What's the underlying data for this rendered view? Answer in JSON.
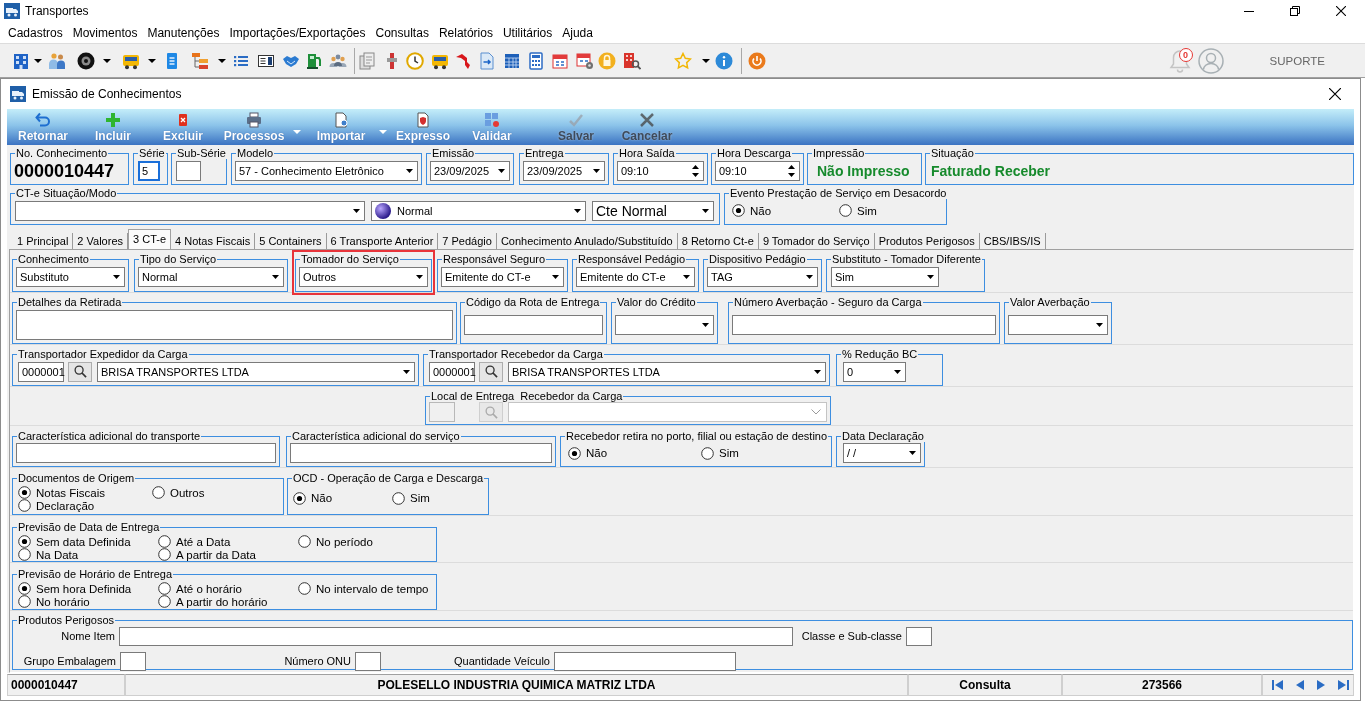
{
  "window": {
    "title": "Transportes"
  },
  "menu": [
    "Cadastros",
    "Movimentos",
    "Manutenções",
    "Importações/Exportações",
    "Consultas",
    "Relatórios",
    "Utilitários",
    "Ajuda"
  ],
  "toolbar": {
    "notifications": "0",
    "user": "SUPORTE"
  },
  "child_window": {
    "title": "Emissão de Conhecimentos"
  },
  "actions": [
    {
      "label": "Retornar",
      "dropdown": false,
      "disabled": false
    },
    {
      "label": "Incluir",
      "dropdown": false,
      "disabled": false
    },
    {
      "label": "Excluir",
      "dropdown": false,
      "disabled": false
    },
    {
      "label": "Processos",
      "dropdown": true,
      "disabled": false
    },
    {
      "label": "Importar",
      "dropdown": true,
      "disabled": false
    },
    {
      "label": "Expresso",
      "dropdown": false,
      "disabled": false
    },
    {
      "label": "Validar",
      "dropdown": false,
      "disabled": false
    },
    {
      "label": "Salvar",
      "dropdown": false,
      "disabled": true
    },
    {
      "label": "Cancelar",
      "dropdown": false,
      "disabled": true
    }
  ],
  "header_rows": [
    [
      {
        "label": "No. Conhecimento",
        "controls": [
          {
            "kind": "display",
            "value": "0000010447"
          }
        ]
      },
      {
        "label": "Série",
        "controls": [
          {
            "kind": "input",
            "value": "5",
            "focused": true
          }
        ]
      },
      {
        "label": "Sub-Série",
        "controls": [
          {
            "kind": "input"
          }
        ]
      },
      {
        "label": "Modelo",
        "controls": [
          {
            "kind": "select",
            "value": "57 - Conhecimento Eletrônico"
          }
        ]
      },
      {
        "label": "Emissão",
        "controls": [
          {
            "kind": "select",
            "value": "23/09/2025"
          }
        ]
      },
      {
        "label": "Entrega",
        "controls": [
          {
            "kind": "select",
            "value": "23/09/2025"
          }
        ]
      },
      {
        "label": "Hora Saída",
        "controls": [
          {
            "kind": "spinner",
            "value": "09:10"
          }
        ]
      },
      {
        "label": "Hora Descarga",
        "controls": [
          {
            "kind": "spinner",
            "value": "09:10"
          }
        ]
      },
      {
        "label": "Impressão",
        "controls": [
          {
            "kind": "status",
            "value": "Não Impresso"
          }
        ]
      },
      {
        "label": "Situação",
        "controls": [
          {
            "kind": "status",
            "value": "Faturado Receber"
          }
        ]
      }
    ],
    [
      {
        "label": "CT-e Situação/Modo",
        "controls": [
          {
            "kind": "select"
          },
          {
            "kind": "iconselect",
            "value": "Normal"
          },
          {
            "kind": "select",
            "value": "Cte Normal"
          }
        ]
      },
      {
        "label": "Evento Prestação de Serviço em Desacordo",
        "controls": [
          {
            "kind": "radio",
            "label": "Não",
            "selected": true
          },
          {
            "kind": "radio",
            "label": "Sim",
            "selected": false
          }
        ]
      }
    ]
  ],
  "tabs": [
    {
      "label": "1 Principal",
      "selected": false
    },
    {
      "label": "2 Valores",
      "selected": false
    },
    {
      "label": "3 CT-e",
      "selected": true
    },
    {
      "label": "4 Notas Fiscais",
      "selected": false
    },
    {
      "label": "5 Containers",
      "selected": false
    },
    {
      "label": "6 Transporte Anterior",
      "selected": false
    },
    {
      "label": "7 Pedágio",
      "selected": false
    },
    {
      "label": "Conhecimento Anulado/Substituído",
      "selected": false
    },
    {
      "label": "8 Retorno Ct-e",
      "selected": false
    },
    {
      "label": "9 Tomador do Serviço",
      "selected": false
    },
    {
      "label": "Produtos Perigosos",
      "selected": false
    },
    {
      "label": "CBS/IBS/IS",
      "selected": false
    }
  ],
  "tab_rows": [
    [
      {
        "label": "Conhecimento",
        "controls": [
          {
            "kind": "select",
            "value": "Substituto"
          }
        ]
      },
      {
        "label": "Tipo do Serviço",
        "controls": [
          {
            "kind": "select",
            "value": "Normal"
          }
        ]
      },
      {
        "label": "Tomador do Serviço",
        "highlighted": true,
        "controls": [
          {
            "kind": "select",
            "value": "Outros"
          }
        ]
      },
      {
        "label": "Responsável Seguro",
        "controls": [
          {
            "kind": "select",
            "value": "Emitente do CT-e"
          }
        ]
      },
      {
        "label": "Responsável Pedágio",
        "controls": [
          {
            "kind": "select",
            "value": "Emitente do CT-e"
          }
        ]
      },
      {
        "label": "Dispositivo Pedágio",
        "controls": [
          {
            "kind": "select",
            "value": "TAG"
          }
        ]
      },
      {
        "label": "Substituto - Tomador Diferente",
        "controls": [
          {
            "kind": "select",
            "value": "Sim"
          }
        ]
      }
    ],
    [
      {
        "label": "Detalhes da Retirada",
        "controls": [
          {
            "kind": "textarea"
          }
        ]
      },
      {
        "label": "Código da Rota de Entrega",
        "controls": [
          {
            "kind": "input"
          }
        ]
      },
      {
        "label": "Valor do Crédito",
        "controls": [
          {
            "kind": "select"
          }
        ]
      },
      {
        "label": "Número Averbação - Seguro da Carga",
        "controls": [
          {
            "kind": "input"
          }
        ]
      },
      {
        "label": "Valor Averbação",
        "controls": [
          {
            "kind": "select"
          }
        ]
      }
    ],
    [
      {
        "label": "Transportador Expedidor da Carga",
        "controls": [
          {
            "kind": "lookup",
            "code": "0000001",
            "value": "BRISA TRANSPORTES LTDA",
            "disabled": false
          }
        ]
      },
      {
        "label": "Transportador Recebedor da Carga",
        "controls": [
          {
            "kind": "lookup",
            "code": "0000001",
            "value": "BRISA TRANSPORTES LTDA",
            "disabled": false
          }
        ]
      },
      {
        "label": "% Redução BC",
        "controls": [
          {
            "kind": "select",
            "value": "0"
          }
        ]
      }
    ],
    [
      {
        "label": "Local de Entrega  Recebedor da Carga",
        "controls": [
          {
            "kind": "lookup",
            "disabled": true
          }
        ]
      }
    ],
    [
      {
        "label": "Característica adicional do transporte",
        "controls": [
          {
            "kind": "input"
          }
        ]
      },
      {
        "label": "Característica adicional do serviço",
        "controls": [
          {
            "kind": "input"
          }
        ]
      },
      {
        "label": "Recebedor retira no porto, filial ou estação de destino",
        "controls": [
          {
            "kind": "radio",
            "label": "Não",
            "selected": true
          },
          {
            "kind": "radio",
            "label": "Sim",
            "selected": false
          }
        ]
      },
      {
        "label": "Data Declaração",
        "controls": [
          {
            "kind": "select",
            "value": "/ /"
          }
        ]
      }
    ],
    [
      {
        "label": "Documentos de Origem",
        "controls": [
          {
            "kind": "radio",
            "label": "Notas Fiscais",
            "selected": true
          },
          {
            "kind": "radio",
            "label": "Outros",
            "selected": false
          },
          {
            "kind": "radio",
            "label": "Declaração",
            "selected": false
          }
        ]
      },
      {
        "label": "OCD - Operação de Carga e Descarga",
        "controls": [
          {
            "kind": "radio",
            "label": "Não",
            "selected": true
          },
          {
            "kind": "radio",
            "label": "Sim",
            "selected": false
          }
        ]
      }
    ],
    [
      {
        "label": "Previsão de Data de Entrega",
        "controls": [
          {
            "kind": "radio",
            "label": "Sem data Definida",
            "selected": true
          },
          {
            "kind": "radio",
            "label": "Até a Data",
            "selected": false
          },
          {
            "kind": "radio",
            "label": "No período",
            "selected": false
          },
          {
            "kind": "radio",
            "label": "Na Data",
            "selected": false
          },
          {
            "kind": "radio",
            "label": "A partir da Data",
            "selected": false
          }
        ]
      }
    ],
    [
      {
        "label": "Previsão de Horário de Entrega",
        "controls": [
          {
            "kind": "radio",
            "label": "Sem hora Definida",
            "selected": true
          },
          {
            "kind": "radio",
            "label": "Até o horário",
            "selected": false
          },
          {
            "kind": "radio",
            "label": "No intervalo de tempo",
            "selected": false
          },
          {
            "kind": "radio",
            "label": "No horário",
            "selected": false
          },
          {
            "kind": "radio",
            "label": "A partir do horário",
            "selected": false
          }
        ]
      }
    ],
    [
      {
        "label": "Produtos Perigosos",
        "controls": [
          {
            "kind": "input",
            "label": "Nome Item"
          },
          {
            "kind": "input",
            "label": "Classe e Sub-classe"
          },
          {
            "kind": "input",
            "label": "Grupo Embalagem"
          },
          {
            "kind": "input",
            "label": "Número ONU"
          },
          {
            "kind": "input",
            "label": "Quantidade Veículo"
          }
        ]
      }
    ]
  ],
  "status_bar": [
    "0000010447",
    "POLESELLO INDUSTRIA QUIMICA MATRIZ LTDA",
    "Consulta",
    "273566"
  ]
}
